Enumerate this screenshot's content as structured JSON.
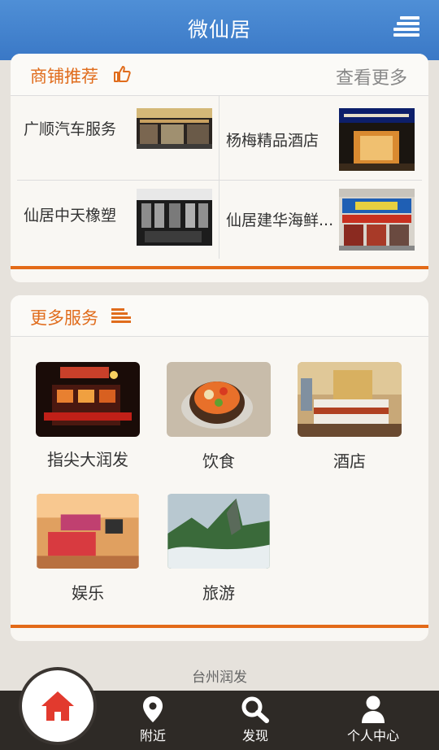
{
  "header": {
    "title": "微仙居"
  },
  "shops": {
    "title": "商铺推荐",
    "more_label": "查看更多",
    "items": [
      {
        "name": "广顺汽车服务"
      },
      {
        "name": "杨梅精品酒店"
      },
      {
        "name": "仙居中天橡塑"
      },
      {
        "name": "仙居建华海鲜..."
      }
    ]
  },
  "services": {
    "title": "更多服务",
    "items": [
      {
        "label": "指尖大润发"
      },
      {
        "label": "饮食"
      },
      {
        "label": "酒店"
      },
      {
        "label": "娱乐"
      },
      {
        "label": "旅游"
      }
    ]
  },
  "footer": {
    "text": "台州润发"
  },
  "nav": {
    "items": [
      {
        "label": "附近"
      },
      {
        "label": "发现"
      },
      {
        "label": "个人中心"
      }
    ]
  },
  "colors": {
    "accent": "#e36a18",
    "header": "#3f7fcc",
    "nav_bg": "#2e2a26",
    "home_icon": "#e23a2e"
  }
}
